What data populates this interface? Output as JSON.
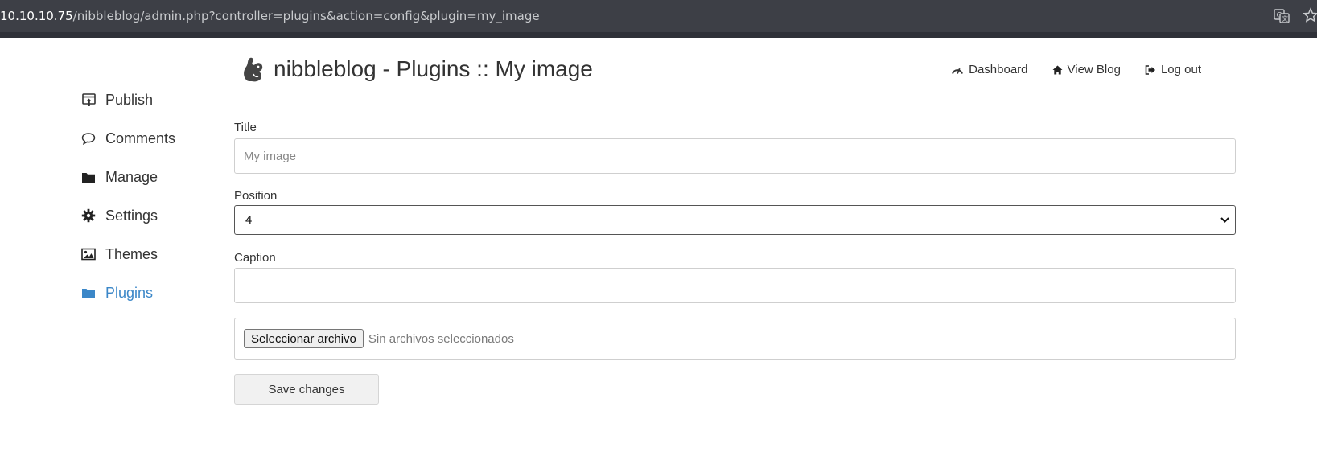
{
  "browser": {
    "url_host": "10.10.10.75",
    "url_path": "/nibbleblog/admin.php?controller=plugins&action=config&plugin=my_image",
    "translate_icon": "translate-icon",
    "bookmark_icon": "star-icon"
  },
  "sidebar": {
    "items": [
      {
        "label": "Publish",
        "icon": "publish-icon"
      },
      {
        "label": "Comments",
        "icon": "speech-bubble-icon"
      },
      {
        "label": "Manage",
        "icon": "folder-icon"
      },
      {
        "label": "Settings",
        "icon": "gear-icon"
      },
      {
        "label": "Themes",
        "icon": "picture-icon"
      },
      {
        "label": "Plugins",
        "icon": "folder-icon",
        "active": true
      }
    ],
    "active_color": "#3b87c8"
  },
  "header": {
    "title": "nibbleblog - Plugins :: My image",
    "logo_icon": "squirrel-logo-icon",
    "nav": {
      "dashboard": "Dashboard",
      "view_blog": "View Blog",
      "log_out": "Log out"
    }
  },
  "form": {
    "title_label": "Title",
    "title_placeholder": "My image",
    "position_label": "Position",
    "position_value": "4",
    "caption_label": "Caption",
    "caption_value": "",
    "file_button": "Seleccionar archivo",
    "file_status": "Sin archivos seleccionados",
    "save_label": "Save changes"
  }
}
